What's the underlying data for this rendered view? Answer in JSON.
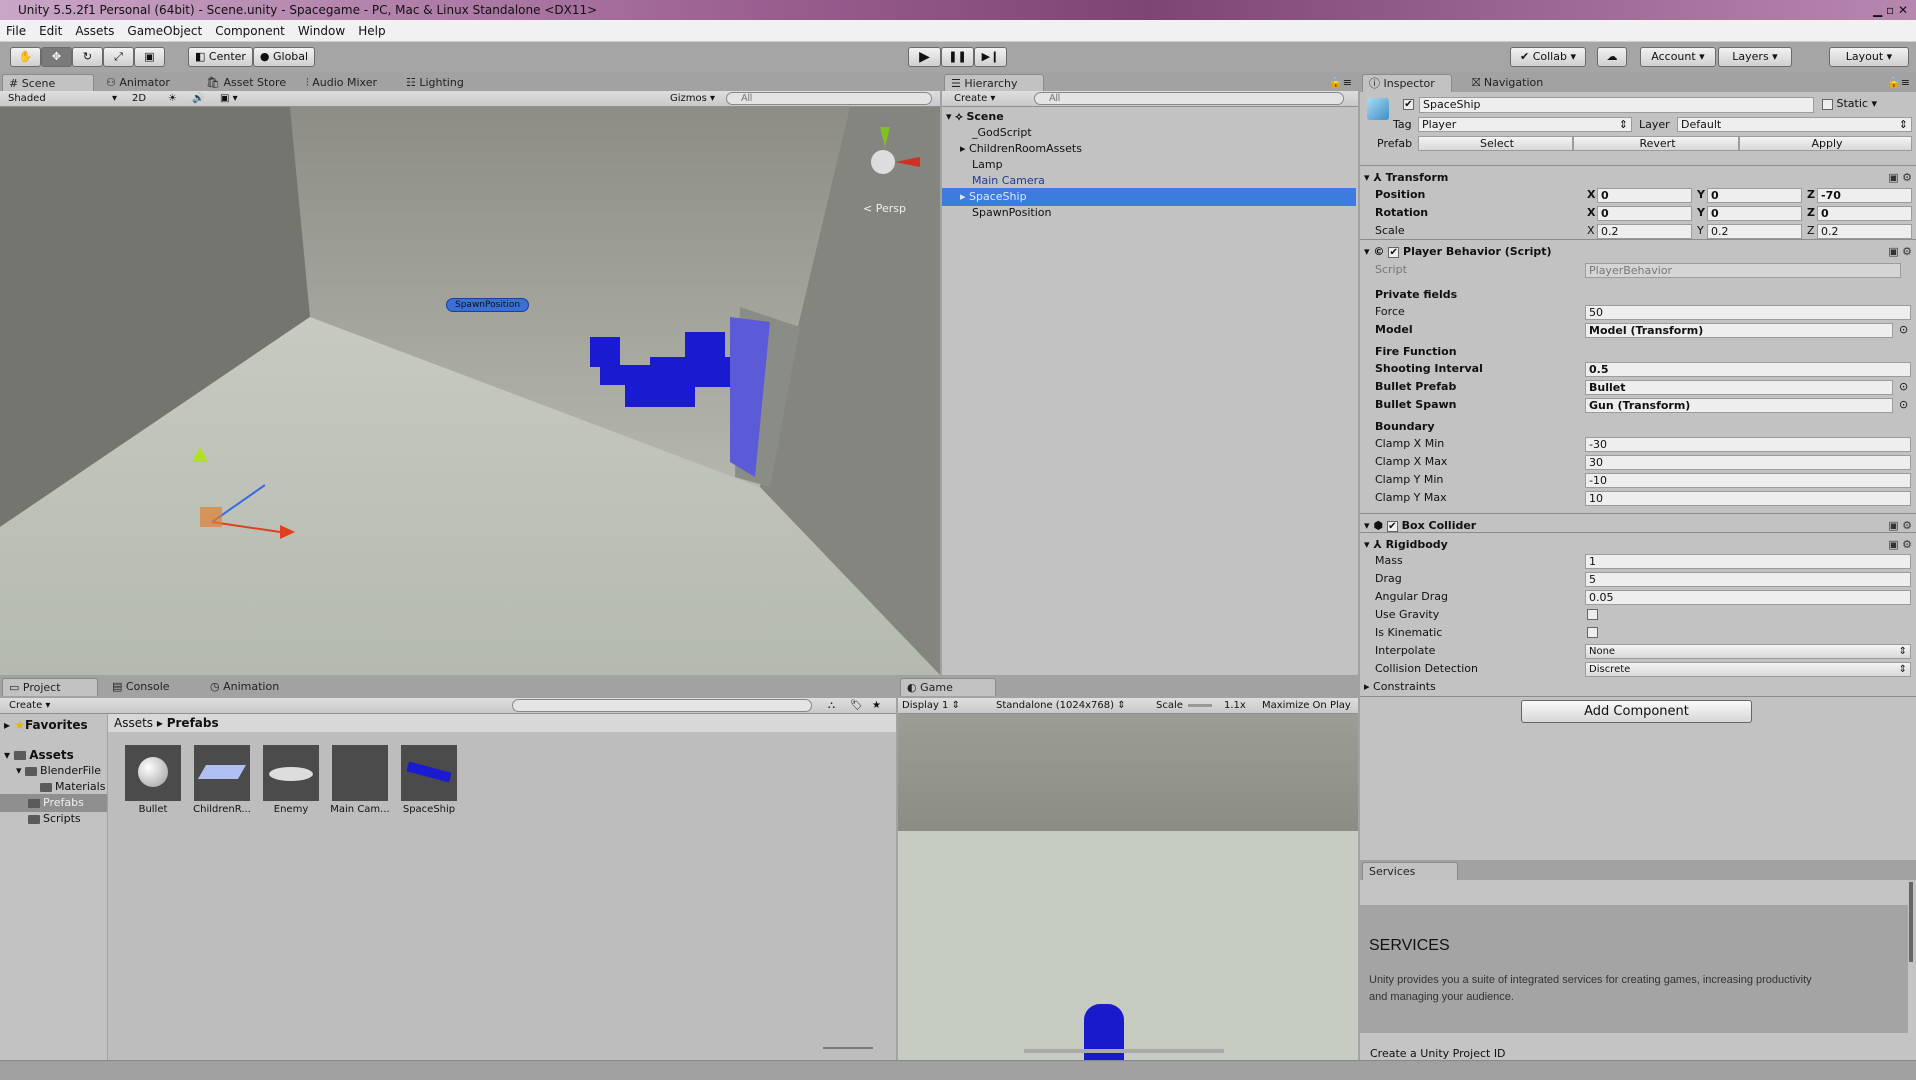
{
  "window": {
    "title": "Unity 5.5.2f1 Personal (64bit) - Scene.unity - Spacegame - PC, Mac & Linux Standalone <DX11>"
  },
  "menu": [
    "File",
    "Edit",
    "Assets",
    "GameObject",
    "Component",
    "Window",
    "Help"
  ],
  "toolbar": {
    "pivot": "Center",
    "space": "Global",
    "collab": "Collab",
    "account": "Account",
    "layers": "Layers",
    "layout": "Layout"
  },
  "scene": {
    "tabs": [
      "Scene",
      "Animator",
      "Asset Store",
      "Audio Mixer",
      "Lighting"
    ],
    "shading": "Shaded",
    "mode2d": "2D",
    "gizmos": "Gizmos",
    "search_placeholder": "All",
    "persp": "Persp",
    "spawn_label": "SpawnPosition"
  },
  "hierarchy": {
    "tab": "Hierarchy",
    "create": "Create",
    "search_placeholder": "All",
    "scene": "Scene",
    "items": [
      "_GodScript",
      "ChildrenRoomAssets",
      "Lamp",
      "Main Camera",
      "SpaceShip",
      "SpawnPosition"
    ],
    "selected": "SpaceShip"
  },
  "inspector": {
    "tabs": [
      "Inspector",
      "Navigation"
    ],
    "name": "SpaceShip",
    "static_label": "Static",
    "tag_label": "Tag",
    "tag": "Player",
    "layer_label": "Layer",
    "layer": "Default",
    "prefab_label": "Prefab",
    "prefab_buttons": [
      "Select",
      "Revert",
      "Apply"
    ],
    "transform": {
      "title": "Transform",
      "rows": [
        {
          "label": "Position",
          "x": "0",
          "y": "0",
          "z": "-70"
        },
        {
          "label": "Rotation",
          "x": "0",
          "y": "0",
          "z": "0"
        },
        {
          "label": "Scale",
          "x": "0.2",
          "y": "0.2",
          "z": "0.2"
        }
      ]
    },
    "player": {
      "title": "Player Behavior (Script)",
      "script_label": "Script",
      "script": "PlayerBehavior",
      "rows": [
        {
          "h": "Private fields"
        },
        {
          "label": "Force",
          "value": "50"
        },
        {
          "label": "Model",
          "value": "Model (Transform)",
          "bold": true,
          "ref": true
        },
        {
          "h": "Fire Function"
        },
        {
          "label": "Shooting Interval",
          "value": "0.5",
          "bold": true
        },
        {
          "label": "Bullet Prefab",
          "value": "Bullet",
          "bold": true,
          "ref": true
        },
        {
          "label": "Bullet Spawn",
          "value": "Gun (Transform)",
          "bold": true,
          "ref": true
        },
        {
          "h": "Boundary"
        },
        {
          "label": "Clamp X Min",
          "value": "-30"
        },
        {
          "label": "Clamp X Max",
          "value": "30"
        },
        {
          "label": "Clamp Y Min",
          "value": "-10"
        },
        {
          "label": "Clamp Y Max",
          "value": "10"
        }
      ]
    },
    "box_collider": {
      "title": "Box Collider"
    },
    "rigidbody": {
      "title": "Rigidbody",
      "rows": [
        {
          "label": "Mass",
          "value": "1"
        },
        {
          "label": "Drag",
          "value": "5"
        },
        {
          "label": "Angular Drag",
          "value": "0.05"
        },
        {
          "label": "Use Gravity",
          "check": false
        },
        {
          "label": "Is Kinematic",
          "check": false
        },
        {
          "label": "Interpolate",
          "value": "None",
          "select": true
        },
        {
          "label": "Collision Detection",
          "value": "Discrete",
          "select": true
        }
      ]
    },
    "constraints": "Constraints",
    "add_component": "Add Component"
  },
  "project": {
    "tabs": [
      "Project",
      "Console",
      "Animation"
    ],
    "create": "Create",
    "favorites": "Favorites",
    "tree": [
      "Assets",
      "BlenderFile",
      "Materials",
      "Prefabs",
      "Scripts"
    ],
    "breadcrumb": [
      "Assets",
      "Prefabs"
    ],
    "assets": [
      "Bullet",
      "ChildrenR...",
      "Enemy",
      "Main Cam...",
      "SpaceShip"
    ]
  },
  "game": {
    "tab": "Game",
    "display": "Display 1",
    "resolution": "Standalone (1024x768)",
    "scale_label": "Scale",
    "scale": "1.1x",
    "maximize": "Maximize On Play"
  },
  "services": {
    "tab": "Services",
    "heading": "SERVICES",
    "body": "Unity provides you a suite of integrated services for creating games, increasing productivity and managing your audience.",
    "link": "Create a Unity Project ID"
  }
}
